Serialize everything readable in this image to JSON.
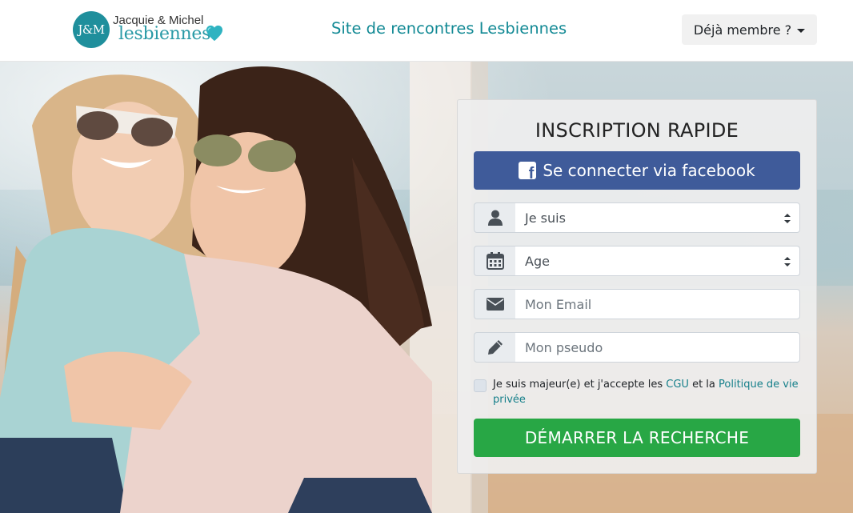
{
  "header": {
    "logo_monogram": "J&M",
    "logo_top": "Jacquie & Michel",
    "logo_bottom": "lesbiennes",
    "site_title": "Site de rencontres Lesbiennes",
    "member_button": "Déjà membre ?"
  },
  "form": {
    "title": "INSCRIPTION RAPIDE",
    "facebook_button": "Se connecter via facebook",
    "gender_select": {
      "value": "Je suis",
      "icon": "user-icon"
    },
    "age_select": {
      "value": "Age",
      "icon": "calendar-icon"
    },
    "email_input": {
      "placeholder": "Mon Email",
      "value": "",
      "icon": "envelope-icon"
    },
    "pseudo_input": {
      "placeholder": "Mon pseudo",
      "value": "",
      "icon": "pencil-icon"
    },
    "consent": {
      "text_before": "Je suis majeur(e) et j'accepte les ",
      "cgu_link": "CGU",
      "text_middle": " et la ",
      "privacy_link": "Politique de vie privée",
      "checked": false
    },
    "submit_button": "DÉMARRER LA RECHERCHE"
  },
  "colors": {
    "brand_teal": "#1f8f9c",
    "facebook_blue": "#3f5b9a",
    "submit_green": "#28a745",
    "link_teal": "#17808b"
  }
}
